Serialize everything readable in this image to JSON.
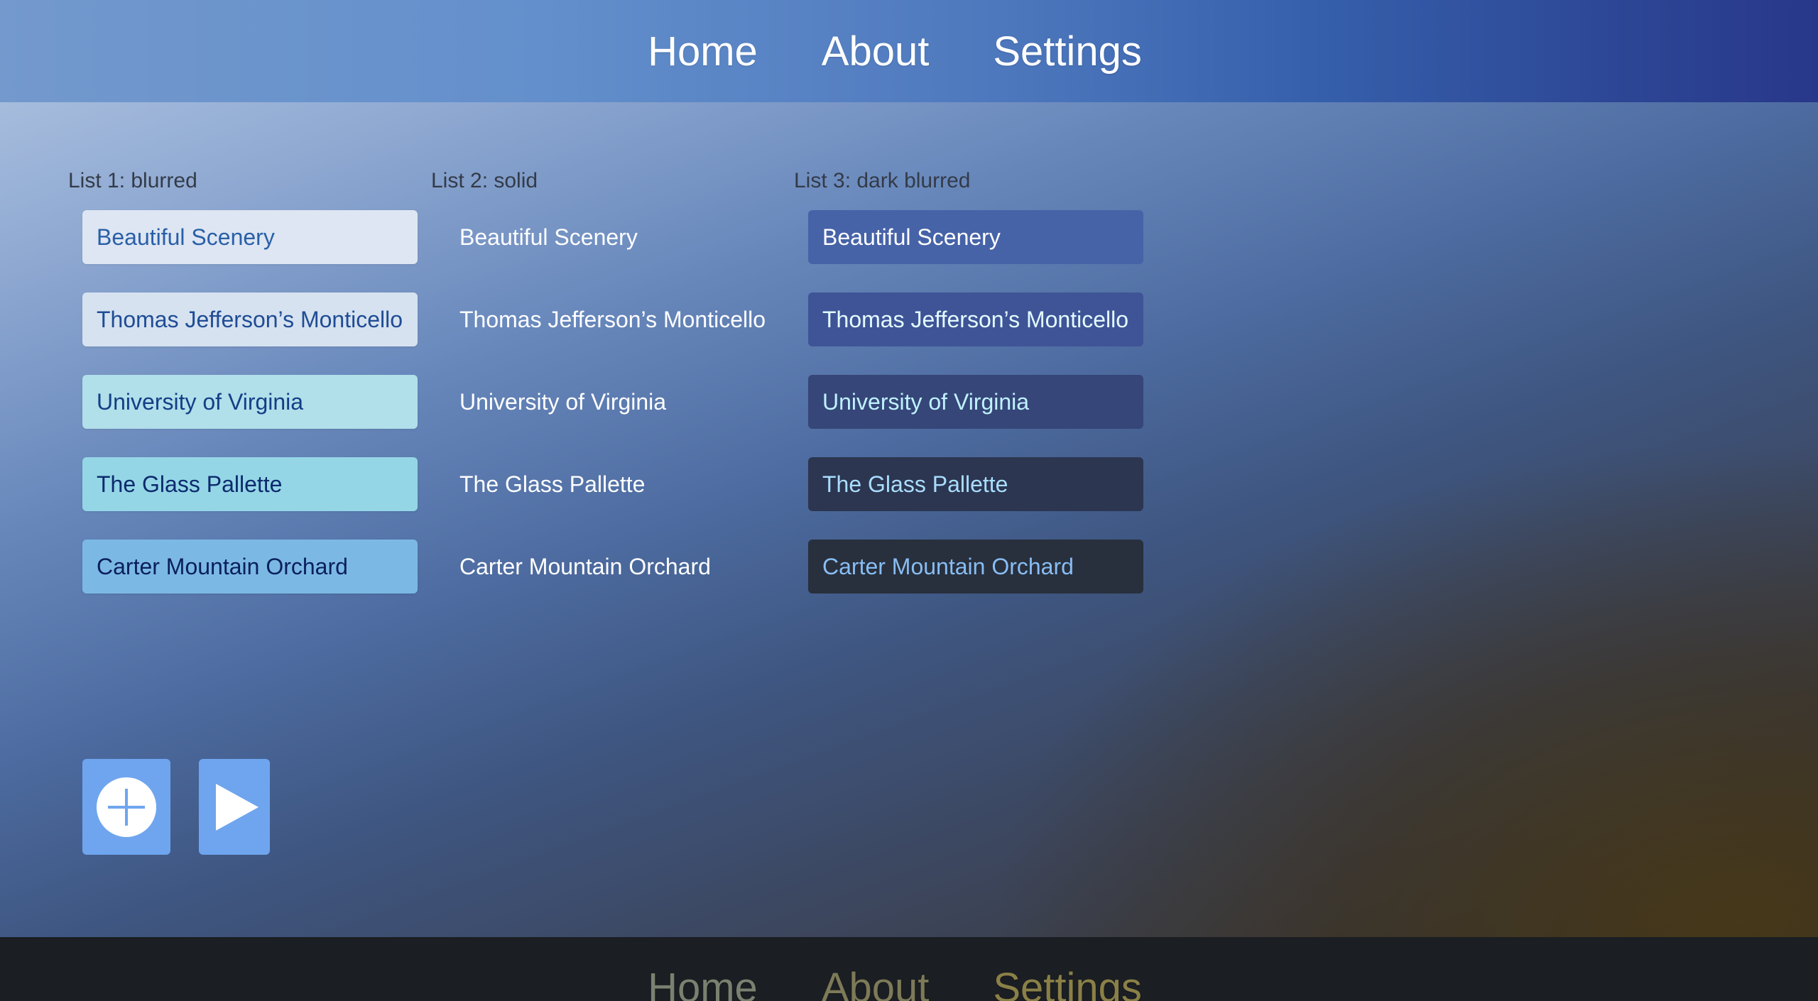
{
  "top_nav": {
    "items": [
      {
        "label": "Home"
      },
      {
        "label": "About"
      },
      {
        "label": "Settings"
      }
    ]
  },
  "lists": [
    {
      "title": "List 1: blurred",
      "items": [
        "Beautiful Scenery",
        "Thomas Jefferson’s Monticello",
        "University of Virginia",
        "The Glass Pallette",
        "Carter Mountain Orchard"
      ]
    },
    {
      "title": "List 2: solid",
      "items": [
        "Beautiful Scenery",
        "Thomas Jefferson’s Monticello",
        "University of Virginia",
        "The Glass Pallette",
        "Carter Mountain Orchard"
      ]
    },
    {
      "title": "List 3: dark blurred",
      "items": [
        "Beautiful Scenery",
        "Thomas Jefferson’s Monticello",
        "University of Virginia",
        "The Glass Pallette",
        "Carter Mountain Orchard"
      ]
    }
  ],
  "actions": {
    "add_icon": "plus-circle-icon",
    "play_icon": "play-icon",
    "accent_color": "#6fa5ee"
  },
  "bottom_nav": {
    "items": [
      {
        "label": "Home"
      },
      {
        "label": "About"
      },
      {
        "label": "Settings"
      }
    ]
  }
}
